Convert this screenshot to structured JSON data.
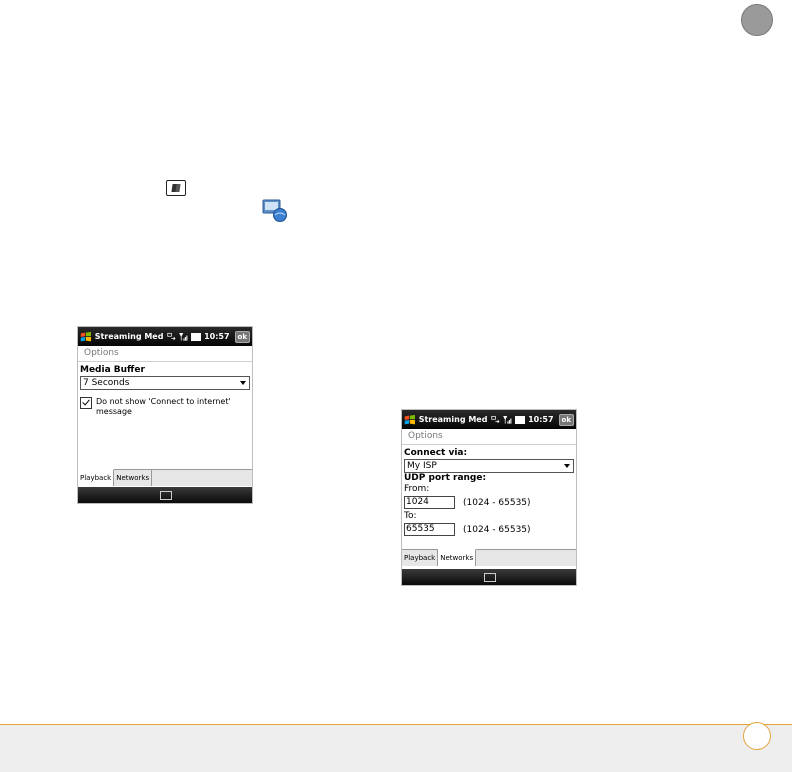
{
  "phone_playback": {
    "title": "Streaming Med",
    "time": "10:57",
    "ok": "ok",
    "options": "Options",
    "media_buffer_label": "Media Buffer",
    "media_buffer_value": "7 Seconds",
    "checkbox_line1": "Do not show 'Connect to internet'",
    "checkbox_line2": "message",
    "checkbox_checked": true,
    "tabs": [
      "Playback",
      "Networks"
    ],
    "active_tab": "Playback"
  },
  "phone_networks": {
    "title": "Streaming Med",
    "time": "10:57",
    "ok": "ok",
    "options": "Options",
    "connect_via_label": "Connect via:",
    "connect_via_value": "My ISP",
    "udp_label": "UDP port range:",
    "from_label": "From:",
    "from_value": "1024",
    "from_range": "(1024 - 65535)",
    "to_label": "To:",
    "to_value": "65535",
    "to_range": "(1024 - 65535)",
    "tabs": [
      "Playback",
      "Networks"
    ],
    "active_tab": "Networks"
  },
  "icons": {
    "start_key": "windows-start-key-icon",
    "streaming_media": "streaming-media-icon",
    "corner_badge": "chapter-tab-icon",
    "page_number": "page-number-circle-icon"
  },
  "colors": {
    "footer_accent": "#e3a33b",
    "footer_band": "#eeeeee",
    "titlebar": "#050505"
  }
}
